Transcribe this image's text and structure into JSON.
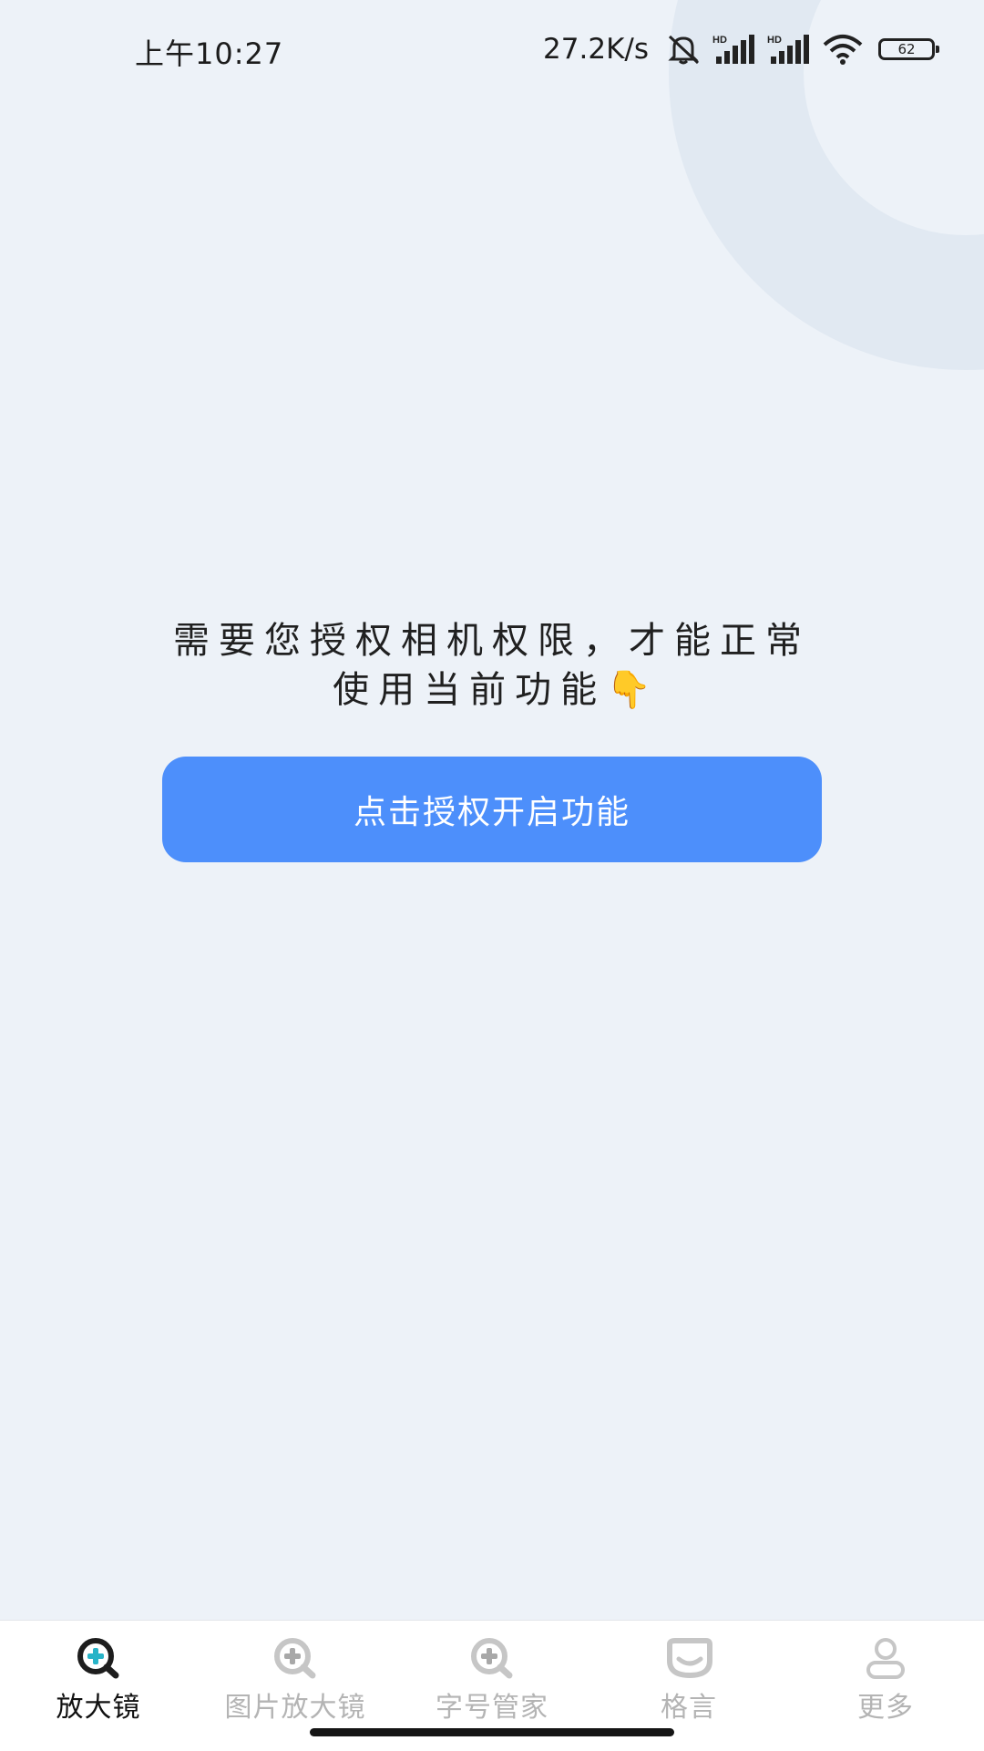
{
  "status_bar": {
    "time": "上午10:27",
    "net_speed": "27.2K/s",
    "battery": "62",
    "hd_label": "HD",
    "icons": [
      "mute-icon",
      "signal-hd-icon",
      "signal-hd-icon",
      "wifi-icon",
      "battery-icon"
    ]
  },
  "main": {
    "message_line1": "需要您授权相机权限，才能正常",
    "message_line2": "使用当前功能",
    "message_emoji": "👇",
    "grant_button_label": "点击授权开启功能"
  },
  "bottom_nav": {
    "items": [
      {
        "label": "放大镜",
        "icon": "magnifier-plus-icon",
        "active": true
      },
      {
        "label": "图片放大镜",
        "icon": "image-magnifier-icon",
        "active": false
      },
      {
        "label": "字号管家",
        "icon": "font-size-magnifier-icon",
        "active": false
      },
      {
        "label": "格言",
        "icon": "quote-bubble-icon",
        "active": false
      },
      {
        "label": "更多",
        "icon": "person-icon",
        "active": false
      }
    ]
  },
  "colors": {
    "background": "#edf2f8",
    "button": "#4d8ffb",
    "active_icon_accent": "#28b4c8",
    "inactive": "#b4b4b4"
  }
}
